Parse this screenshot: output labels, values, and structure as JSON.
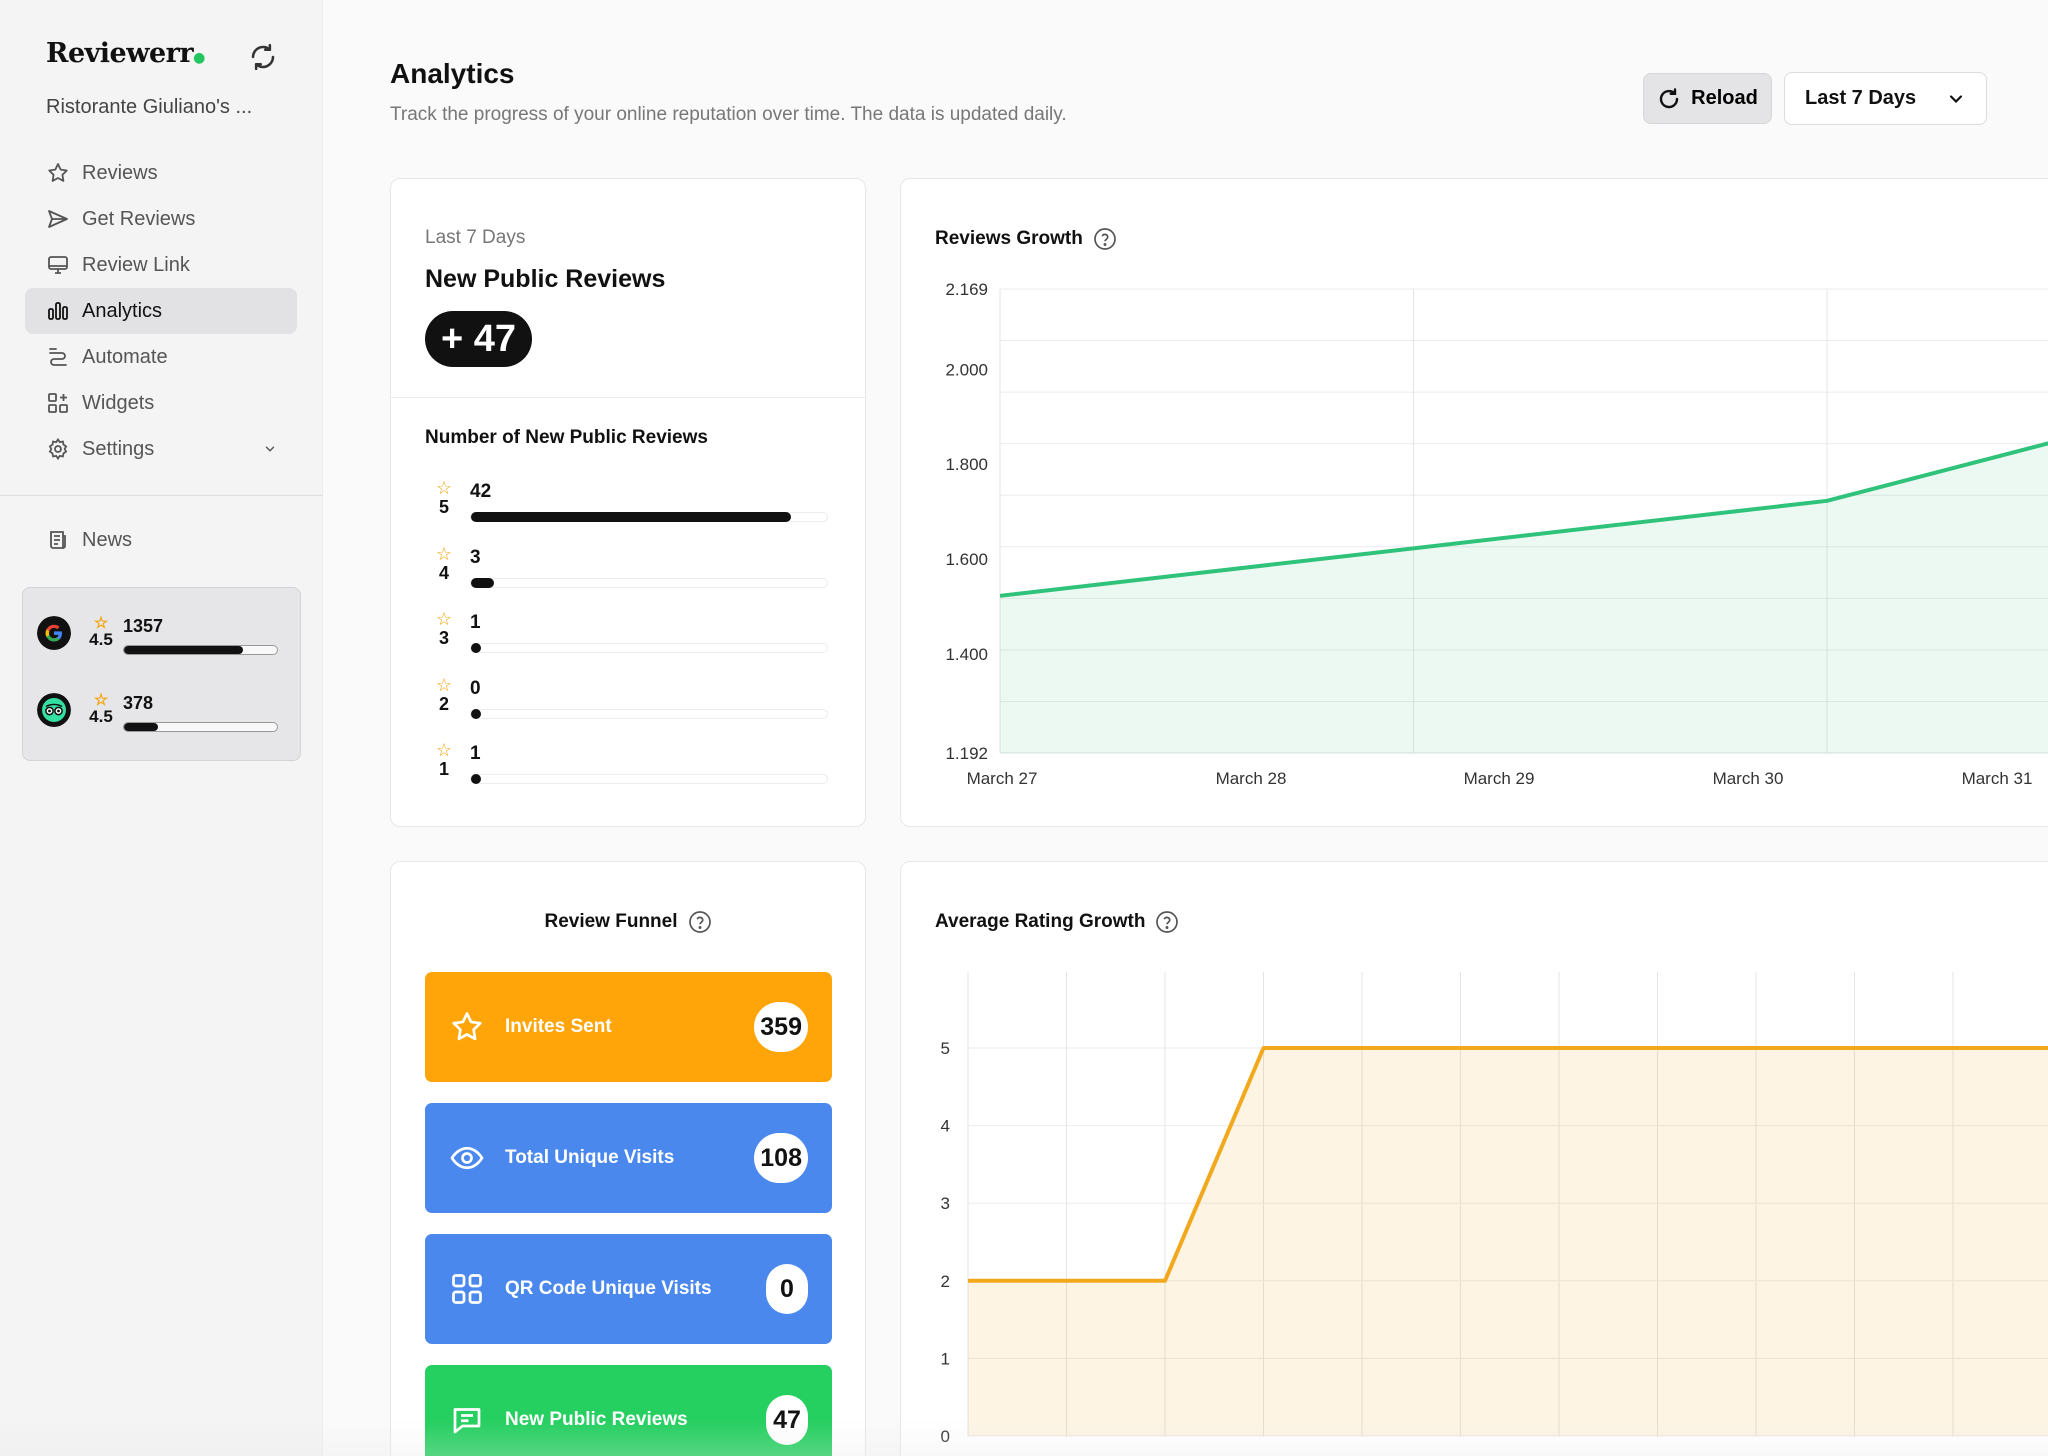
{
  "app": {
    "brand": "Reviewerr",
    "brand_dot": "●",
    "org_name": "Ristorante Giuliano's ..."
  },
  "sidebar": {
    "items": [
      {
        "label": "Reviews",
        "icon": "star-icon"
      },
      {
        "label": "Get Reviews",
        "icon": "send-icon"
      },
      {
        "label": "Review Link",
        "icon": "monitor-icon"
      },
      {
        "label": "Analytics",
        "icon": "bar-chart-icon",
        "active": true
      },
      {
        "label": "Automate",
        "icon": "automate-icon"
      },
      {
        "label": "Widgets",
        "icon": "widgets-icon"
      },
      {
        "label": "Settings",
        "icon": "gear-icon"
      }
    ],
    "news": "News",
    "platforms": [
      {
        "name_icon": "google-icon",
        "rating": "4.5",
        "count": "1357",
        "fill": 0.78
      },
      {
        "name_icon": "tripadvisor-icon",
        "rating": "4.5",
        "count": "378",
        "fill": 0.22
      }
    ]
  },
  "header": {
    "title": "Analytics",
    "subtitle": "Track the progress of your online reputation over time. The data is updated daily.",
    "reload_label": "Reload",
    "range_value": "Last 7 Days"
  },
  "summary": {
    "period": "Last 7 Days",
    "title": "New Public Reviews",
    "badge": "+ 47",
    "dist_title": "Number of New Public Reviews",
    "distribution": [
      {
        "stars": "5",
        "count": "42",
        "value": 42
      },
      {
        "stars": "4",
        "count": "3",
        "value": 3
      },
      {
        "stars": "3",
        "count": "1",
        "value": 1
      },
      {
        "stars": "2",
        "count": "0",
        "value": 0
      },
      {
        "stars": "1",
        "count": "1",
        "value": 1
      }
    ],
    "max": 47
  },
  "funnel": {
    "title": "Review Funnel",
    "items": [
      {
        "label": "Invites Sent",
        "value": "359",
        "icon": "star-outline-icon",
        "color": "#ffa50a"
      },
      {
        "label": "Total Unique Visits",
        "value": "108",
        "icon": "eye-icon",
        "color": "#4a88ee"
      },
      {
        "label": "QR Code Unique Visits",
        "value": "0",
        "icon": "qr-code-icon",
        "color": "#4a88ee"
      },
      {
        "label": "New Public Reviews",
        "value": "47",
        "icon": "chat-bubble-icon",
        "color": "#25cf60"
      }
    ]
  },
  "colors": {
    "growth_line": "#2fc27a",
    "rating_line": "#f2a81d",
    "accent": "#22c55e"
  },
  "chart_data": [
    {
      "type": "area",
      "title": "Reviews Growth",
      "categories": [
        "March 27",
        "March 28",
        "March 29",
        "March 30",
        "March 31"
      ],
      "y_ticks": [
        "2.169",
        "2.000",
        "1.800",
        "1.600",
        "1.400",
        "1.192"
      ],
      "ylim": [
        1192,
        2169
      ],
      "series": [
        {
          "x_index": [
            0,
            2,
            4,
            5
          ],
          "values": [
            1523,
            1723,
            1851,
            1851
          ]
        }
      ]
    },
    {
      "type": "area",
      "title": "Average Rating Growth",
      "y_ticks": [
        "5",
        "4",
        "3",
        "2",
        "1",
        "0"
      ],
      "ylim": [
        0,
        5.5
      ],
      "series": [
        {
          "values": [
            2,
            2,
            2,
            5,
            5,
            5,
            5,
            5,
            5,
            5,
            5,
            5,
            5,
            5,
            5,
            5
          ]
        }
      ]
    }
  ]
}
